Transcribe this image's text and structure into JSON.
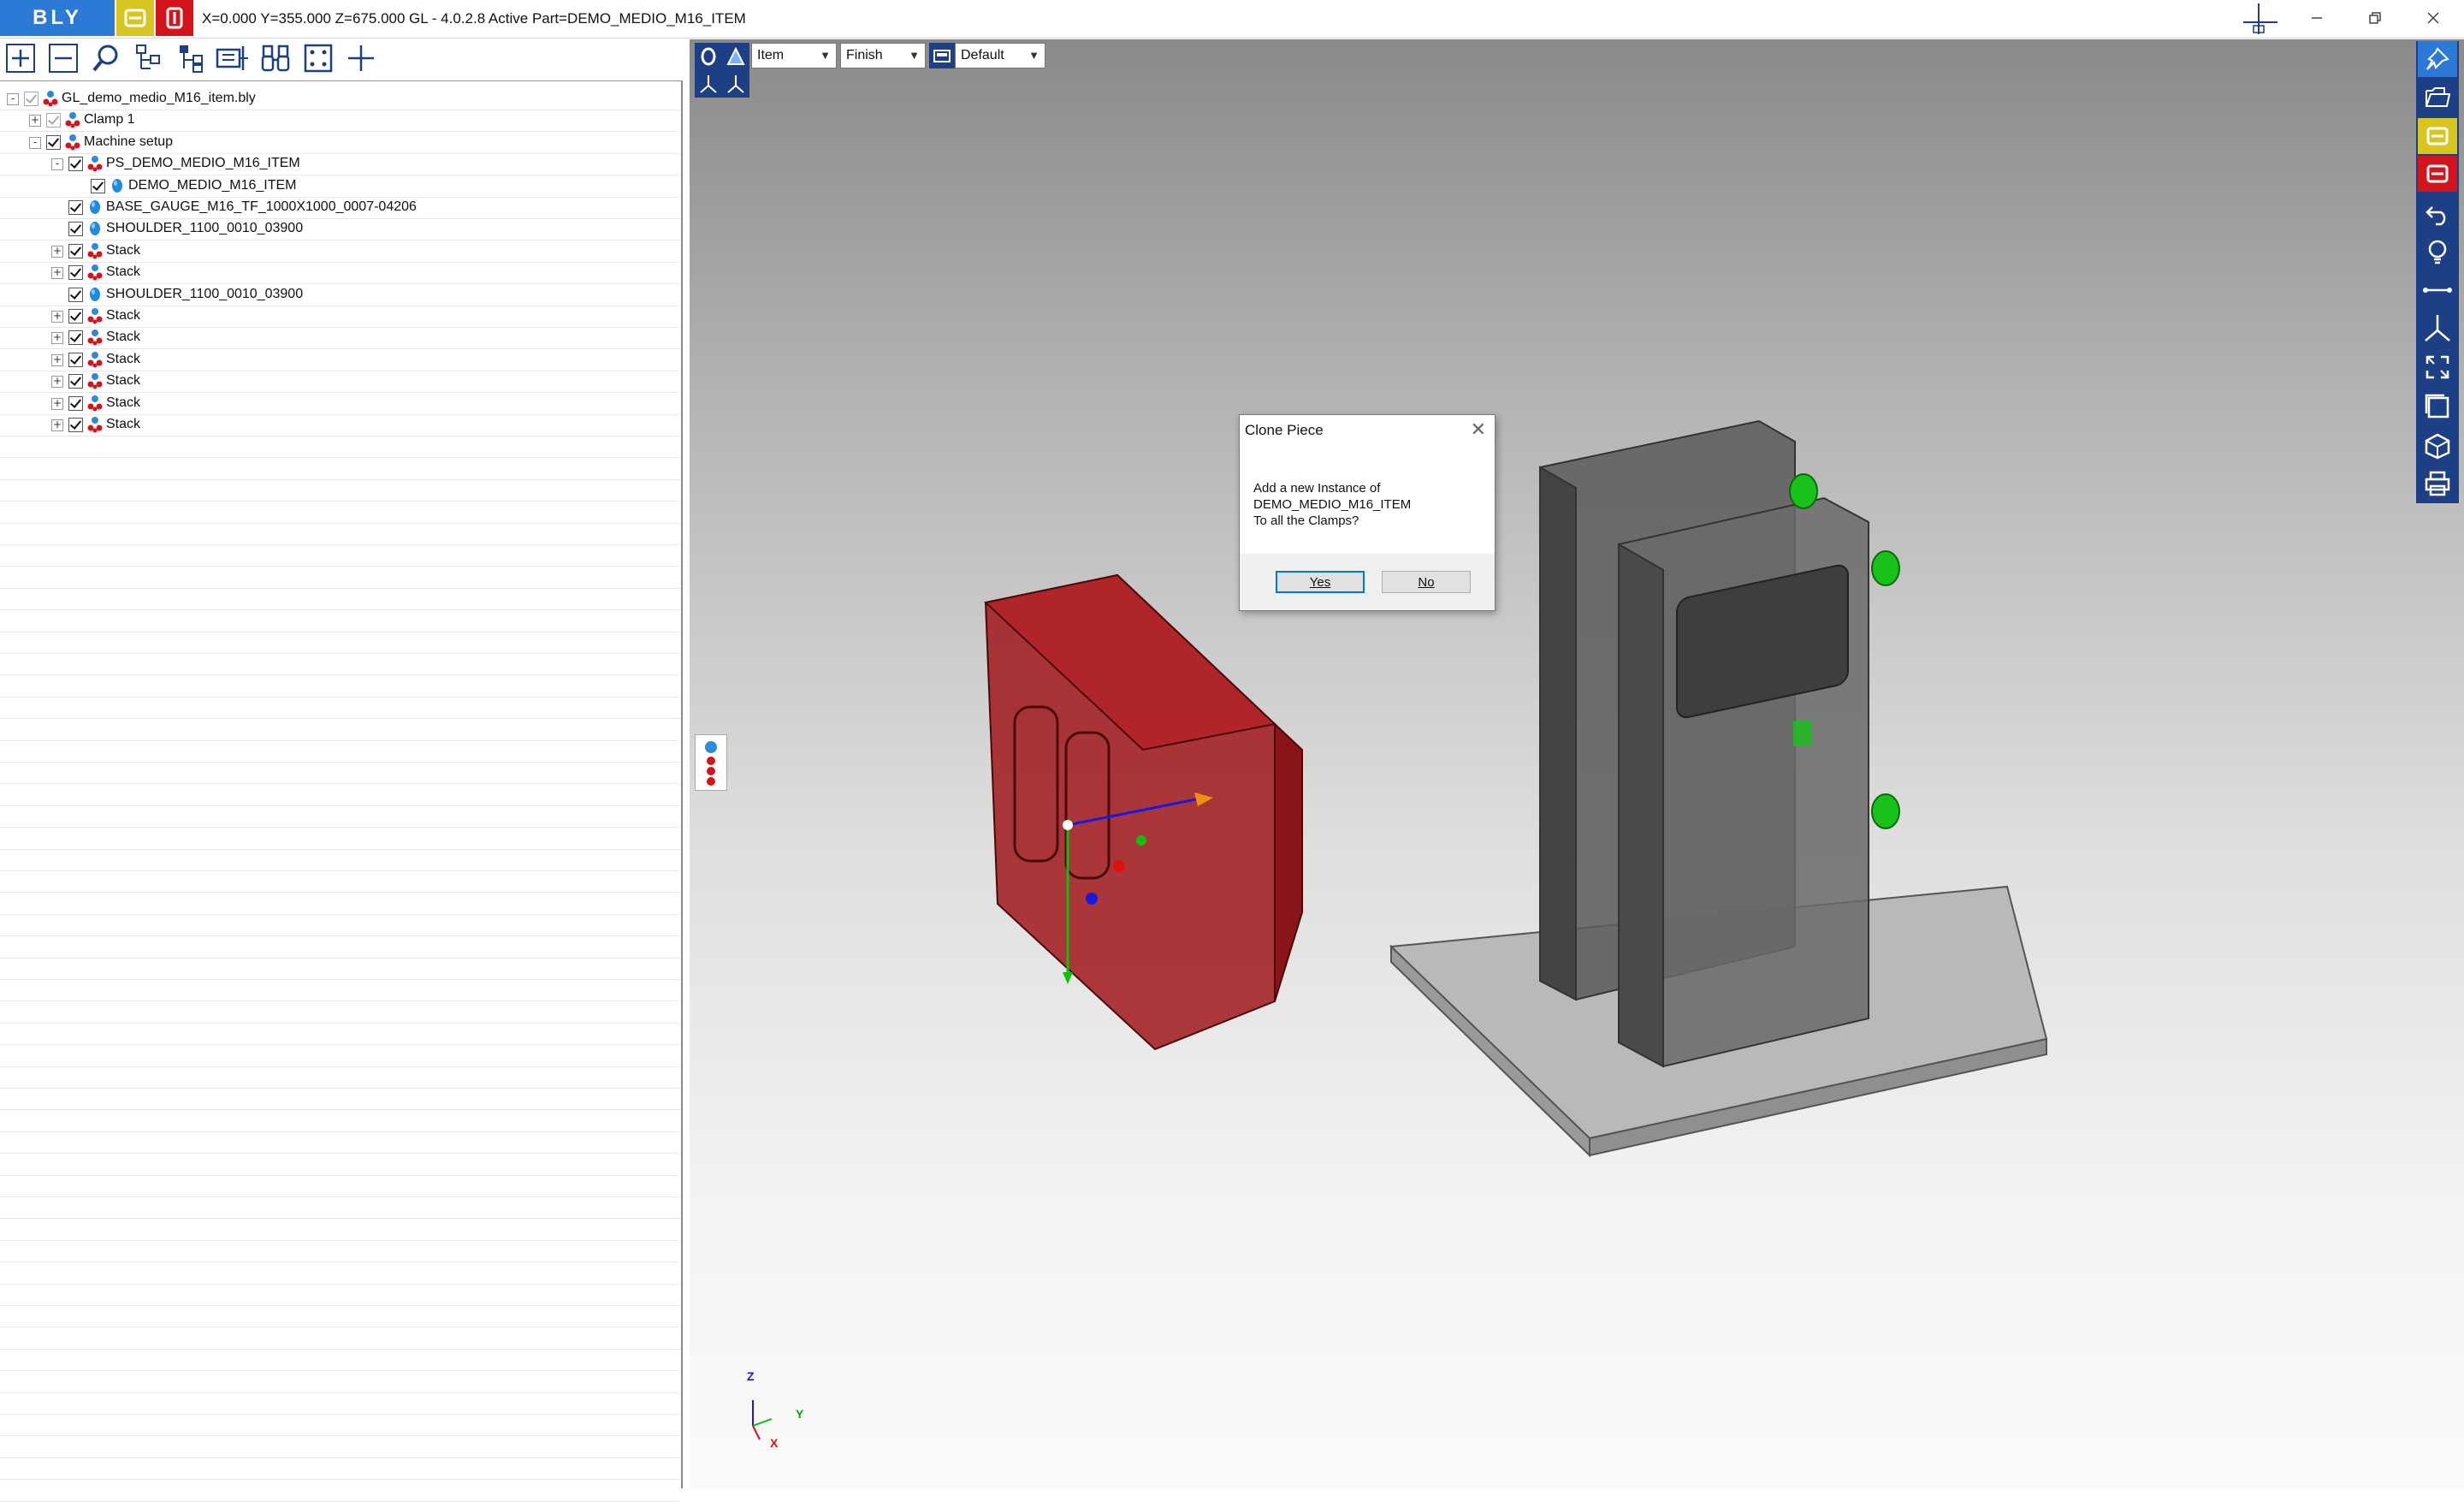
{
  "titlebar": {
    "logo": "BLY",
    "coords": "X=0.000 Y=355.000 Z=675.000",
    "app_info": "GL - 4.0.2.8 Active Part=DEMO_MEDIO_M16_ITEM",
    "minimize_icon": "minimize-icon",
    "maximize_icon": "restore-icon",
    "close_icon": "close-icon"
  },
  "toolbar": {
    "icons": [
      "expand-all-icon",
      "collapse-all-icon",
      "search-icon",
      "tree-structure-icon",
      "tree-branch-icon",
      "dimension-icon",
      "binoculars-icon",
      "fit-frame-icon",
      "crosshair-icon"
    ]
  },
  "tree": {
    "items": [
      {
        "label": "GL_demo_medio_M16_item.bly"
      },
      {
        "label": "Clamp 1"
      },
      {
        "label": "Machine setup"
      },
      {
        "label": "PS_DEMO_MEDIO_M16_ITEM"
      },
      {
        "label": "DEMO_MEDIO_M16_ITEM"
      },
      {
        "label": "BASE_GAUGE_M16_TF_1000X1000_0007-04206"
      },
      {
        "label": "SHOULDER_1100_0010_03900"
      },
      {
        "label": "Stack"
      },
      {
        "label": "Stack"
      },
      {
        "label": "SHOULDER_1100_0010_03900"
      },
      {
        "label": "Stack"
      },
      {
        "label": "Stack"
      },
      {
        "label": "Stack"
      },
      {
        "label": "Stack"
      },
      {
        "label": "Stack"
      },
      {
        "label": "Stack"
      }
    ]
  },
  "viewport": {
    "selects": {
      "mode": "Item",
      "quality": "Finish",
      "view": "Default"
    },
    "axis": {
      "z": "Z",
      "y": "Y",
      "x": "X"
    }
  },
  "right_toolbar": {
    "icons": [
      "pin-icon",
      "open-folder-icon",
      "yellow-bly-icon",
      "red-bly-icon",
      "undo-icon",
      "lightbulb-icon",
      "measure-icon",
      "axis-icon",
      "expand-icon",
      "window-icon",
      "cube-icon",
      "print-icon"
    ]
  },
  "dialog": {
    "title": "Clone Piece",
    "line1": "Add a new Instance of",
    "line2": "DEMO_MEDIO_M16_ITEM",
    "line3": "To all the Clamps?",
    "yes": "Yes",
    "no": "No"
  },
  "colors": {
    "accent": "#2d7ad6",
    "yellow": "#d9c51f",
    "red": "#d4141c",
    "rbar": "#1d3f86",
    "part": "#a0181c"
  }
}
